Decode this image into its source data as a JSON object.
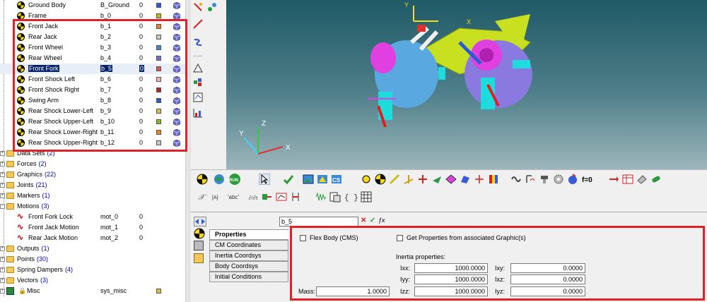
{
  "tree": {
    "bodies": [
      {
        "label": "Ground Body",
        "var": "B_Ground",
        "active": "0",
        "color": "#2a5bd7"
      },
      {
        "label": "Frame",
        "var": "b_0",
        "active": "0",
        "color": "#c8b400"
      },
      {
        "label": "Front Jack",
        "var": "b_1",
        "active": "0",
        "color": "#f08020"
      },
      {
        "label": "Rear Jack",
        "var": "b_2",
        "active": "0",
        "color": "#c8c8c8"
      },
      {
        "label": "Front Wheel",
        "var": "b_3",
        "active": "0",
        "color": "#3a8ad8"
      },
      {
        "label": "Rear Wheel",
        "var": "b_4",
        "active": "0",
        "color": "#7a6ad8"
      },
      {
        "label": "Front Fork",
        "var": "b_5",
        "active": "0",
        "color": "#e05050"
      },
      {
        "label": "Front Shock Left",
        "var": "b_6",
        "active": "0",
        "color": "#f0b0b0"
      },
      {
        "label": "Front Shock Right",
        "var": "b_7",
        "active": "0",
        "color": "#c02020"
      },
      {
        "label": "Swing Arm",
        "var": "b_8",
        "active": "0",
        "color": "#2a5bd7"
      },
      {
        "label": "Rear Shock Lower-Left",
        "var": "b_9",
        "active": "0",
        "color": "#d8c040"
      },
      {
        "label": "Rear Shock Upper-Left",
        "var": "b_10",
        "active": "0",
        "color": "#80c020"
      },
      {
        "label": "Rear Shock Lower-Right",
        "var": "b_11",
        "active": "0",
        "color": "#f08020"
      },
      {
        "label": "Rear Shock Upper-Right",
        "var": "b_12",
        "active": "0",
        "color": "#c8c8c8"
      }
    ],
    "folders_a": [
      {
        "label": "Data Sets",
        "count": "(2)"
      },
      {
        "label": "Forces",
        "count": "(2)"
      },
      {
        "label": "Graphics",
        "count": "(22)"
      },
      {
        "label": "Joints",
        "count": "(21)"
      },
      {
        "label": "Markers",
        "count": "(1)"
      },
      {
        "label": "Motions",
        "count": "(3)"
      }
    ],
    "motions": [
      {
        "label": "Front Fork Lock",
        "var": "mot_0",
        "active": "0"
      },
      {
        "label": "Front Jack Motion",
        "var": "mot_1",
        "active": "0"
      },
      {
        "label": "Rear Jack Motion",
        "var": "mot_2",
        "active": "0"
      }
    ],
    "folders_b": [
      {
        "label": "Outputs",
        "count": "(1)"
      },
      {
        "label": "Points",
        "count": "(30)"
      },
      {
        "label": "Spring Dampers",
        "count": "(4)"
      },
      {
        "label": "Vectors",
        "count": "(3)"
      }
    ],
    "misc": {
      "label": "Misc",
      "var": "sys_misc"
    }
  },
  "viewport": {
    "axis_x": "X",
    "axis_y": "Y",
    "axis_z": "Z",
    "model_y": "Y",
    "model_x": "X",
    "accent": "#4af0ff"
  },
  "toolbar": {
    "run_label": "RUN",
    "f0_label": "f=0",
    "text_label": "abc",
    "braces_label": "{ }"
  },
  "editor": {
    "name_value": "b_5",
    "tabs": [
      "Properties",
      "CM Coordinates",
      "Inertia Coordsys",
      "Body Coordsys",
      "Initial Conditions"
    ],
    "flex_body_label": "Flex Body (CMS)",
    "get_props_label": "Get Properties from associated Graphic(s)",
    "inertia_heading": "Inertia properties:",
    "mass_label": "Mass:",
    "mass_value": "1.0000",
    "ixx_label": "Ixx:",
    "ixx_value": "1000.0000",
    "iyy_label": "Iyy:",
    "iyy_value": "1000.0000",
    "izz_label": "Izz:",
    "izz_value": "1000.0000",
    "ixy_label": "Ixy:",
    "ixy_value": "0.0000",
    "ixz_label": "Ixz:",
    "ixz_value": "0.0000",
    "iyz_label": "Iyz:",
    "iyz_value": "0.0000"
  }
}
